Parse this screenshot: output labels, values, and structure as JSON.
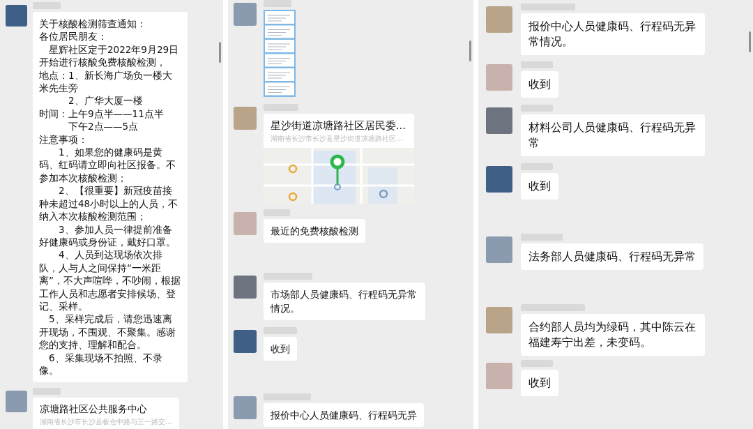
{
  "panels": [
    {
      "messages": [
        {
          "kind": "text",
          "paragraphs": [
            "关于核酸检测筛查通知：",
            "各位居民朋友：",
            "　星辉社区定于2022年9月29日开始进行核酸免费核酸检测，",
            "地点：1、新长海广场负一楼大米先生旁",
            "　　　2、广华大厦一楼",
            "时间：上午9点半——11点半",
            "　　　下午2点——5点",
            "注意事项：",
            "　　1、如果您的健康码是黄码、红码请立即向社区报备。不参加本次核酸检测；",
            "　　2、【很重要】新冠疫苗接种未超过48小时以上的人员，不纳入本次核酸检测范围；",
            "　　3、参加人员一律提前准备好健康码或身份证，戴好口罩。",
            "　　4、人员到达现场依次排队，人与人之间保持“一米距离”，不大声喧哗，不吵闹，根据工作人员和志愿者安排候场、登记、采样。",
            "　5、采样完成后，请您迅速离开现场，不围观、不聚集。感谢您的支持、理解和配合。",
            "　6、采集现场不拍照、不录像。"
          ]
        },
        {
          "kind": "location",
          "title": "凉塘路社区公共服务中心",
          "address": "湖南省长沙市长沙县板仓中路与三一路交..."
        }
      ]
    },
    {
      "messages": [
        {
          "kind": "image"
        },
        {
          "kind": "location",
          "title": "星沙街道凉塘路社区居民委...",
          "address": "湖南省长沙市长沙县星沙街道凉塘路社区..."
        },
        {
          "kind": "text",
          "paragraphs": [
            "最近的免费核酸检测"
          ]
        },
        {
          "kind": "text",
          "paragraphs": [
            "市场部人员健康码、行程码无异常情况。"
          ]
        },
        {
          "kind": "text",
          "paragraphs": [
            "收到"
          ]
        },
        {
          "kind": "text",
          "paragraphs": [
            "报价中心人员健康码、行程码无异"
          ]
        }
      ]
    },
    {
      "messages": [
        {
          "kind": "text",
          "paragraphs": [
            "报价中心人员健康码、行程码无异常情况。"
          ]
        },
        {
          "kind": "text",
          "paragraphs": [
            "收到"
          ]
        },
        {
          "kind": "text",
          "paragraphs": [
            "材料公司人员健康码、行程码无异常"
          ]
        },
        {
          "kind": "text",
          "paragraphs": [
            "收到"
          ]
        },
        {
          "kind": "text",
          "paragraphs": [
            "法务部人员健康码、行程码无异常"
          ]
        },
        {
          "kind": "text",
          "paragraphs": [
            "合约部人员均为绿码，其中陈云在福建寿宁出差，未变码。"
          ]
        },
        {
          "kind": "text",
          "paragraphs": [
            "收到"
          ]
        }
      ]
    }
  ]
}
